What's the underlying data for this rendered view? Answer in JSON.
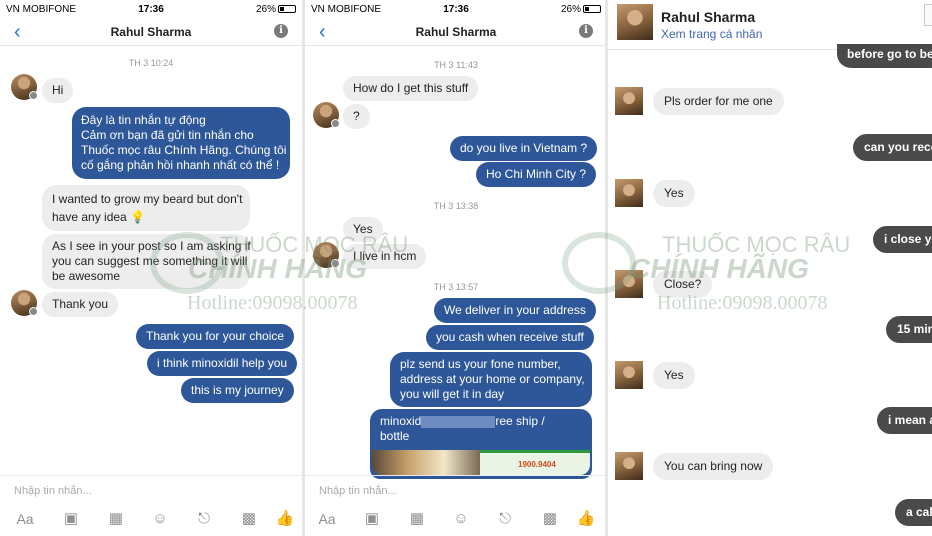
{
  "status": {
    "carrier": "VN MOBIFONE",
    "time": "17:36",
    "battery": "26%"
  },
  "contact": {
    "name": "Rahul Sharma",
    "profile_link": "Xem trang cá nhân"
  },
  "composer": {
    "placeholder": "Nhập tin nhắn...",
    "aa": "Aa"
  },
  "watermark": {
    "line1": "THUỐC MỌC RÂU",
    "line2": "CHÍNH HÃNG",
    "line3": "Hotline:09098.00078"
  },
  "panel1": {
    "timestamp": "TH 3 10:24",
    "msg1": "Hi",
    "msg2_l1": "Đây là tin nhắn tự động",
    "msg2_l2": "Cảm ơn bạn đã gửi tin nhắn cho",
    "msg2_l3": "Thuốc mọc râu Chính Hãng. Chúng tôi",
    "msg2_l4": "cố gắng phản hồi nhanh nhất có thể !",
    "msg3_l1": "I wanted to grow my beard but don't",
    "msg3_l2": "have any idea",
    "msg4_l1": "As I see in your post so I am asking if",
    "msg4_l2": "you can suggest me something it will",
    "msg4_l3": "be awesome",
    "msg5": "Thank you",
    "msg6": "Thank you for your choice",
    "msg7": "i think minoxidil help you",
    "msg8": "this is my journey"
  },
  "panel2": {
    "ts1": "TH 3 11:43",
    "msg1": "How do I get this stuff",
    "msg2": "?",
    "msg3": "do you live in Vietnam ?",
    "msg4": "Ho Chi Minh City ?",
    "ts2": "TH 3 13:38",
    "msg5": "Yes",
    "msg6": "I live in hcm",
    "ts3": "TH 3 13:57",
    "msg7": "We deliver in your address",
    "msg8": "you cash when receive stuff",
    "msg9_l1": "plz send us your fone number,",
    "msg9_l2": "address at your home or company,",
    "msg9_l3": "you will get it in day",
    "msg10_a": "minoxid",
    "msg10_b": "ree ship /",
    "msg10_l2": "bottle",
    "img_phone": "1900.9404"
  },
  "panel3": {
    "msg_partial1": "before go to be",
    "msg1": "Pls order for me one",
    "msg_partial2": "can you rece",
    "msg2": "Yes",
    "msg_partial3": "i close yo",
    "msg3": "Close?",
    "msg_partial4": "15 min",
    "msg4": "Yes",
    "msg_partial5": "i mean a",
    "msg5": "You can bring now",
    "msg_partial6": "a cal"
  }
}
